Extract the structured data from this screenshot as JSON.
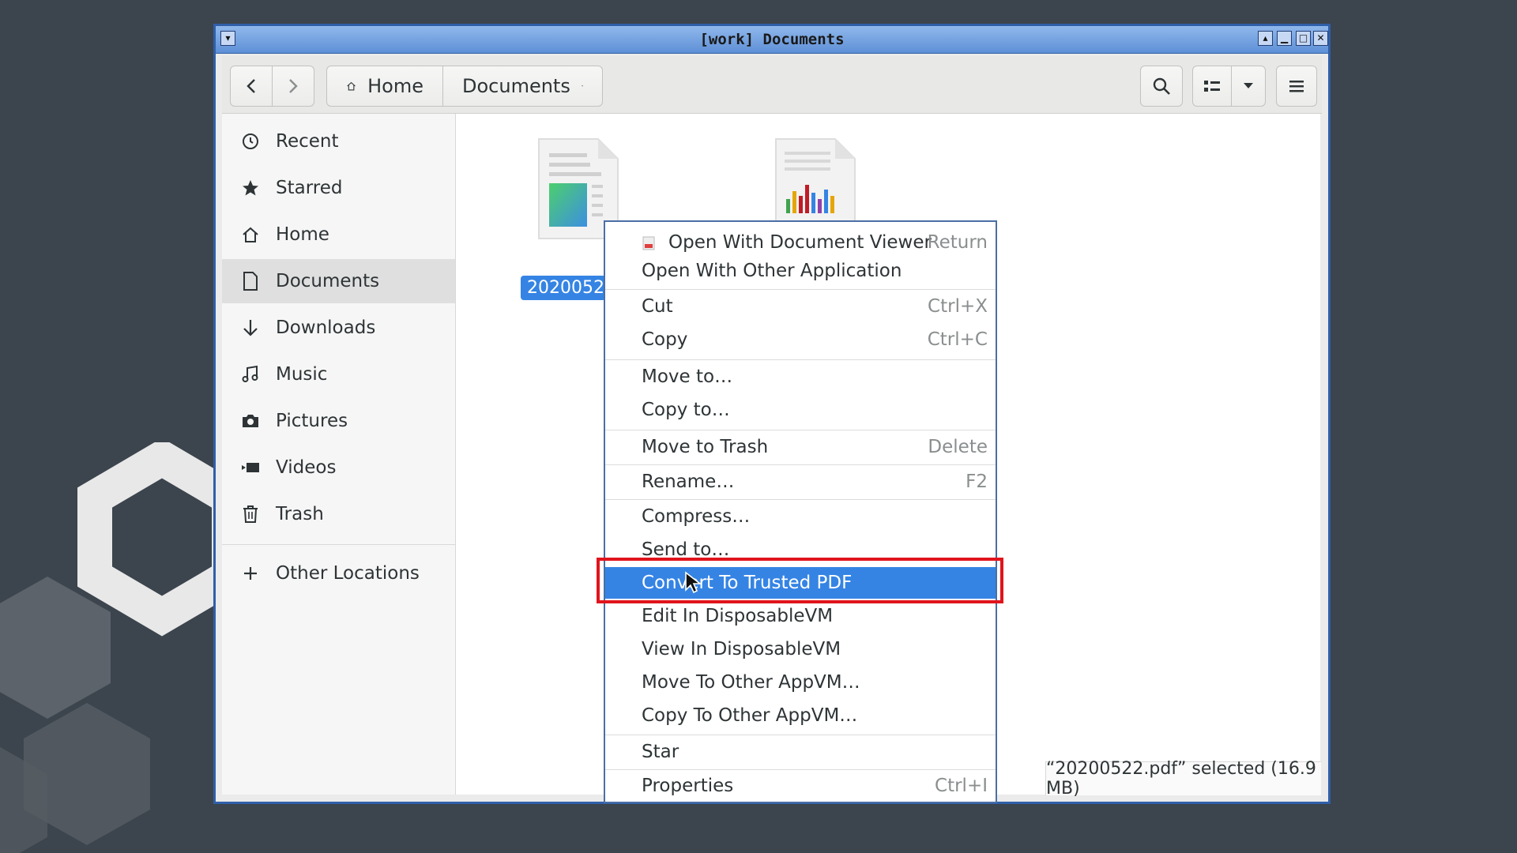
{
  "window": {
    "title": "[work] Documents"
  },
  "header": {
    "path": [
      "Home",
      "Documents"
    ]
  },
  "sidebar": {
    "items": [
      {
        "label": "Recent",
        "icon": "clock-icon"
      },
      {
        "label": "Starred",
        "icon": "star-icon"
      },
      {
        "label": "Home",
        "icon": "home-icon"
      },
      {
        "label": "Documents",
        "icon": "document-icon",
        "active": true
      },
      {
        "label": "Downloads",
        "icon": "download-icon"
      },
      {
        "label": "Music",
        "icon": "music-icon"
      },
      {
        "label": "Pictures",
        "icon": "camera-icon"
      },
      {
        "label": "Videos",
        "icon": "video-icon"
      },
      {
        "label": "Trash",
        "icon": "trash-icon"
      }
    ],
    "other_locations": "Other Locations"
  },
  "files": [
    {
      "name": "2020052",
      "type": "pdf-document",
      "selected": true
    },
    {
      "name": "",
      "type": "spreadsheet-chart"
    }
  ],
  "status": {
    "text": "“20200522.pdf” selected  (16.9 MB)"
  },
  "context_menu": {
    "items": [
      {
        "label": "Open With Document Viewer",
        "accel": "Return",
        "icon": "document-viewer-icon"
      },
      {
        "label": "Open With Other Application",
        "accel": ""
      },
      {
        "label": "Cut",
        "accel": "Ctrl+X"
      },
      {
        "label": "Copy",
        "accel": "Ctrl+C"
      },
      {
        "label": "Move to…",
        "accel": ""
      },
      {
        "label": "Copy to…",
        "accel": ""
      },
      {
        "label": "Move to Trash",
        "accel": "Delete"
      },
      {
        "label": "Rename…",
        "accel": "F2"
      },
      {
        "label": "Compress…",
        "accel": ""
      },
      {
        "label": "Send to…",
        "accel": ""
      },
      {
        "label": "Convert To Trusted PDF",
        "accel": "",
        "highlighted": true
      },
      {
        "label": "Edit In DisposableVM",
        "accel": ""
      },
      {
        "label": "View In DisposableVM",
        "accel": ""
      },
      {
        "label": "Move To Other AppVM…",
        "accel": ""
      },
      {
        "label": "Copy To Other AppVM…",
        "accel": ""
      },
      {
        "label": "Star",
        "accel": ""
      },
      {
        "label": "Properties",
        "accel": "Ctrl+I"
      }
    ]
  },
  "colors": {
    "accent": "#3584e4",
    "annotation": "#e0141c",
    "titlebar": "#5e8fd6",
    "desktop": "#3c444d"
  }
}
